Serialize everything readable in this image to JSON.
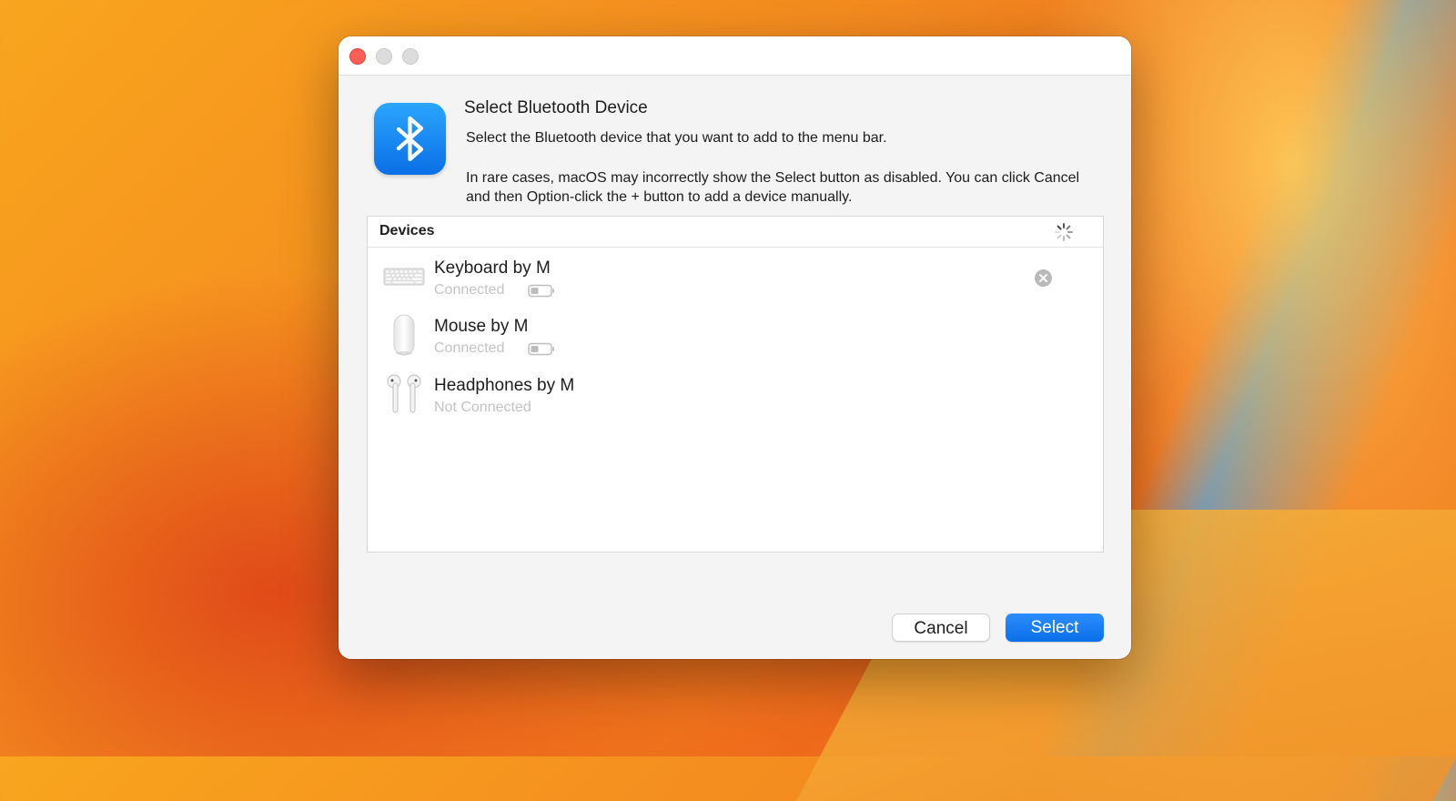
{
  "dialog": {
    "title": "Select Bluetooth Device",
    "message": "Select the Bluetooth device that you want to add to the menu bar.",
    "note": "In rare cases, macOS may incorrectly show the Select button as disabled. You can click Cancel and then Option-click the + button to add a device manually.",
    "app_icon": "bluetooth-icon",
    "accent_color": "#0a6fe8"
  },
  "table": {
    "header": "Devices",
    "loading_icon": "spinner-icon",
    "devices": [
      {
        "name": "Keyboard by M",
        "status": "Connected",
        "icon": "keyboard-icon",
        "battery": "low",
        "removable": true
      },
      {
        "name": "Mouse by M",
        "status": "Connected",
        "icon": "mouse-icon",
        "battery": "low",
        "removable": false
      },
      {
        "name": "Headphones by M",
        "status": "Not Connected",
        "icon": "airpods-icon",
        "removable": false
      }
    ]
  },
  "buttons": {
    "cancel": "Cancel",
    "select": "Select"
  }
}
